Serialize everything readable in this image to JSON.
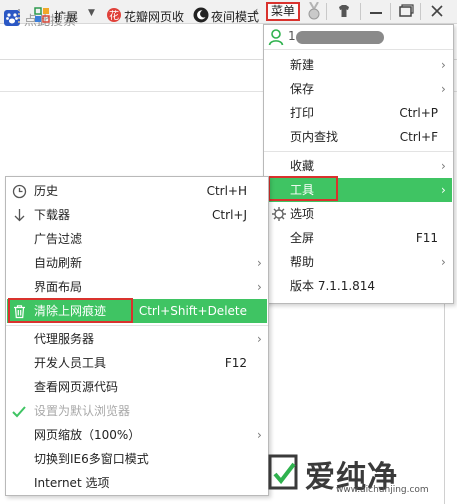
{
  "titlebar": {
    "menu_label": "菜单"
  },
  "search": {
    "placeholder": "点此搜索"
  },
  "toolbar": {
    "extension_label": "扩展",
    "huaban_label": "花瓣网页收",
    "night_mode_label": "夜间模式"
  },
  "main_menu": {
    "account_initial": "1",
    "items": [
      {
        "label": "新建",
        "shortcut": "",
        "submenu": true
      },
      {
        "label": "保存",
        "shortcut": "",
        "submenu": true
      },
      {
        "label": "打印",
        "shortcut": "Ctrl+P",
        "submenu": false
      },
      {
        "label": "页内查找",
        "shortcut": "Ctrl+F",
        "submenu": false
      },
      {
        "label": "收藏",
        "shortcut": "",
        "submenu": true
      },
      {
        "label": "工具",
        "shortcut": "",
        "submenu": true
      },
      {
        "label": "选项",
        "shortcut": "",
        "submenu": false
      },
      {
        "label": "全屏",
        "shortcut": "F11",
        "submenu": false
      },
      {
        "label": "帮助",
        "shortcut": "",
        "submenu": true
      },
      {
        "label": "版本 7.1.1.814",
        "shortcut": "",
        "submenu": false
      }
    ]
  },
  "tools_menu": {
    "items": [
      {
        "label": "历史",
        "shortcut": "Ctrl+H"
      },
      {
        "label": "下载器",
        "shortcut": "Ctrl+J"
      },
      {
        "label": "广告过滤",
        "shortcut": ""
      },
      {
        "label": "自动刷新",
        "shortcut": ""
      },
      {
        "label": "界面布局",
        "shortcut": ""
      },
      {
        "label": "清除上网痕迹",
        "shortcut": "Ctrl+Shift+Delete"
      },
      {
        "label": "代理服务器",
        "shortcut": ""
      },
      {
        "label": "开发人员工具",
        "shortcut": "F12"
      },
      {
        "label": "查看网页源代码",
        "shortcut": ""
      },
      {
        "label": "设置为默认浏览器",
        "shortcut": ""
      },
      {
        "label": "网页缩放（100%）",
        "shortcut": ""
      },
      {
        "label": "切换到IE6多窗口模式",
        "shortcut": ""
      },
      {
        "label": "Internet 选项",
        "shortcut": ""
      }
    ]
  },
  "watermark": {
    "text": "爱纯净",
    "url": "www.aichunjing.com"
  },
  "colors": {
    "highlight": "#3fc463",
    "annotation_red": "#d9322d",
    "disabled": "#a8a8a8"
  }
}
